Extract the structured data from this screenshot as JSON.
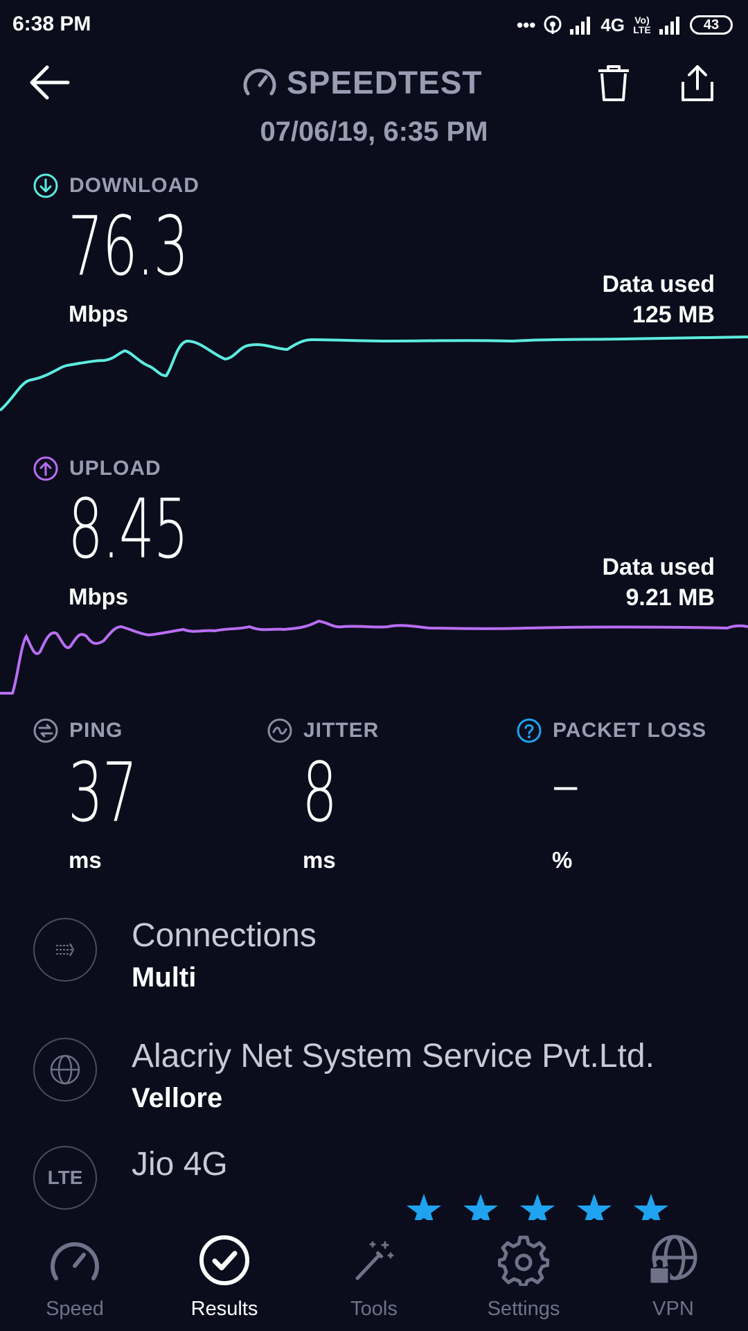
{
  "status_bar": {
    "time": "6:38 PM",
    "network": "4G",
    "volte": "Vo) LTE",
    "battery": "43"
  },
  "header": {
    "title": "SPEEDTEST",
    "date": "07/06/19, 6:35 PM"
  },
  "download": {
    "label": "DOWNLOAD",
    "value": "76.3",
    "unit": "Mbps",
    "data_used_label": "Data used",
    "data_used_value": "125 MB",
    "color": "#5cecdf"
  },
  "upload": {
    "label": "UPLOAD",
    "value": "8.45",
    "unit": "Mbps",
    "data_used_label": "Data used",
    "data_used_value": "9.21 MB",
    "color": "#b86ef2"
  },
  "ping": {
    "label": "PING",
    "value": "37",
    "unit": "ms"
  },
  "jitter": {
    "label": "JITTER",
    "value": "8",
    "unit": "ms"
  },
  "packet_loss": {
    "label": "PACKET LOSS",
    "value": "–",
    "unit": "%",
    "color": "#1fa3f0"
  },
  "connections": {
    "title": "Connections",
    "value": "Multi",
    "icon": "arrows-icon"
  },
  "provider": {
    "title": "Alacriy Net System Service Pvt.Ltd.",
    "value": "Vellore",
    "icon": "globe-icon"
  },
  "network": {
    "badge": "LTE",
    "title": "Jio 4G"
  },
  "rating": {
    "stars": 5,
    "color": "#1fa3f0"
  },
  "nav": {
    "items": [
      {
        "label": "Speed",
        "icon": "speedometer-icon"
      },
      {
        "label": "Results",
        "icon": "checkmark-circle-icon",
        "active": true
      },
      {
        "label": "Tools",
        "icon": "magic-wand-icon"
      },
      {
        "label": "Settings",
        "icon": "gear-icon"
      },
      {
        "label": "VPN",
        "icon": "globe-lock-icon"
      }
    ]
  }
}
